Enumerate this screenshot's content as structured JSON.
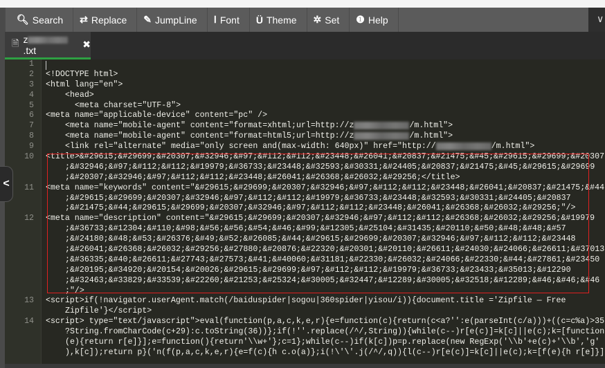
{
  "toolbar": {
    "buttons": [
      {
        "icon": "search-icon",
        "glyph": "🔍︎",
        "label": "Search"
      },
      {
        "icon": "replace-icon",
        "glyph": "⇄",
        "label": "Replace"
      },
      {
        "icon": "pin-icon",
        "glyph": "✎",
        "label": "JumpLine"
      },
      {
        "icon": "font-icon",
        "glyph": "Ⅰ",
        "label": "Font"
      },
      {
        "icon": "magnet-icon",
        "glyph": "Ü",
        "label": "Theme"
      },
      {
        "icon": "gear-icon",
        "glyph": "✲",
        "label": "Set"
      },
      {
        "icon": "help-icon",
        "glyph": "❶",
        "label": "Help"
      }
    ],
    "more_glyph": "∨"
  },
  "tab": {
    "name_start": "z",
    "name_end": ".txt",
    "close": "✖"
  },
  "collapse_glyph": "<",
  "rows": [
    {
      "n": "1",
      "t": "",
      "c": ""
    },
    {
      "n": "2",
      "t": "<!DOCTYPE html>",
      "c": ""
    },
    {
      "n": "3",
      "t": "<html lang=\"en\">",
      "c": ""
    },
    {
      "n": "4",
      "t": "<head>",
      "c": "i1"
    },
    {
      "n": "5",
      "t": "<meta charset=\"UTF-8\">",
      "c": "i2"
    },
    {
      "n": "6",
      "t": "<meta name=\"applicable-device\" content=\"pc\" />",
      "c": ""
    },
    {
      "n": "7",
      "t": "<meta name=\"mobile-agent\" content=\"format=xhtml;url=http://z",
      "b": "/m.html\">",
      "c": "w"
    },
    {
      "n": "8",
      "t": "<meta name=\"mobile-agent\" content=\"format=html5;url=http://z",
      "b": "/m.html\">",
      "c": "w"
    },
    {
      "n": "9",
      "t": "<link rel=\"alternate\" media=\"only screen and(max-width: 640px)\" href=\"http://",
      "b": "/m.html\">",
      "c": "w"
    },
    {
      "n": "10",
      "t": "<title>&#29615;&#29699;&#20307;&#32946;&#97;&#112;&#112;&#23448;&#26041;&#20837;&#21475;&#45;&#29615;&#29699;&#20307",
      "c": ""
    },
    {
      "n": "",
      "t": ";&#32946;&#97;&#112;&#112;&#19979;&#36733;&#23448;&#32593;&#30331;&#24405;&#20837;&#21475;&#45;&#29615;&#29699",
      "c": "w"
    },
    {
      "n": "",
      "t": ";&#20307;&#32946;&#97;&#112;&#112;&#23448;&#26041;&#26368;&#26032;&#29256;</title>",
      "c": "w"
    },
    {
      "n": "11",
      "t": "<meta name=\"keywords\" content=\"&#29615;&#29699;&#20307;&#32946;&#97;&#112;&#112;&#23448;&#26041;&#20837;&#21475;&#44",
      "c": ""
    },
    {
      "n": "",
      "t": ";&#29615;&#29699;&#20307;&#32946;&#97;&#112;&#112;&#19979;&#36733;&#23448;&#32593;&#30331;&#24405;&#20837",
      "c": "w"
    },
    {
      "n": "",
      "t": ";&#21475;&#44;&#29615;&#29699;&#20307;&#32946;&#97;&#112;&#112;&#23448;&#26041;&#26368;&#26032;&#29256;\"/>",
      "c": "w"
    },
    {
      "n": "12",
      "t": "<meta name=\"description\" content=\"&#29615;&#29699;&#20307;&#32946;&#97;&#112;&#112;&#26368;&#26032;&#29256;&#19979",
      "c": ""
    },
    {
      "n": "",
      "t": ";&#36733;&#12304;&#110;&#98;&#56;&#56;&#54;&#46;&#99;&#12305;&#25104;&#31435;&#20110;&#50;&#48;&#48;&#57",
      "c": "w"
    },
    {
      "n": "",
      "t": ";&#24180;&#48;&#53;&#26376;&#49;&#52;&#26085;&#44;&#29615;&#29699;&#20307;&#32946;&#97;&#112;&#112;&#23448",
      "c": "w"
    },
    {
      "n": "",
      "t": ";&#26041;&#26368;&#26032;&#29256;&#27880;&#20876;&#22320;&#20301;&#20110;&#26611;&#24030;&#24066;&#26611;&#37013",
      "c": "w"
    },
    {
      "n": "",
      "t": ";&#36335;&#40;&#26611;&#27743;&#27573;&#41;&#40060;&#31181;&#22330;&#26032;&#24066;&#22330;&#44;&#27861;&#23450",
      "c": "w"
    },
    {
      "n": "",
      "t": ";&#20195;&#34920;&#20154;&#20026;&#29615;&#29699;&#97;&#112;&#112;&#19979;&#36733;&#23433;&#35013;&#12290",
      "c": "w"
    },
    {
      "n": "",
      "t": ";&#32463;&#33829;&#33539;&#22260;&#21253;&#25324;&#30005;&#32447;&#12289;&#30005;&#32518;&#12289;&#46;&#46;&#46",
      "c": "w"
    },
    {
      "n": "",
      "t": ";\"/>",
      "c": "w"
    },
    {
      "n": "13",
      "t": "<script>if(!navigator.userAgent.match(/baiduspider|sogou|360spider|yisou/i)){document.title ='Zipfile — Free",
      "c": ""
    },
    {
      "n": "",
      "t": "Zipfile'}</script>",
      "c": "w"
    },
    {
      "n": "14",
      "t": "<script> type=\"text/javascript\">eval(function(p,a,c,k,e,r){e=function(c){return(c<a?'':e(parseInt(c/a)))+((c=c%a)>35",
      "c": ""
    },
    {
      "n": "",
      "t": "?String.fromCharCode(c+29):c.toString(36))};if(!''.replace(/^/,String)){while(c--)r[e(c)]=k[c]||e(c);k=[function",
      "c": "w"
    },
    {
      "n": "",
      "t": "(e){return r[e]}];e=function(){return'\\\\w+'};c=1};while(c--)if(k[c])p=p.replace(new RegExp('\\\\b'+e(c)+'\\\\b','g'",
      "c": "w"
    },
    {
      "n": "",
      "t": "),k[c]);return p}('n(f(p,a,c,k,e,r){e=f(c){h c.o(a)};i(!\\'\\'.j(/^/,q)){l(c--)r[e(c)]=k[c]||e(c);k=[f(e){h r[e]}]",
      "c": "w"
    }
  ]
}
